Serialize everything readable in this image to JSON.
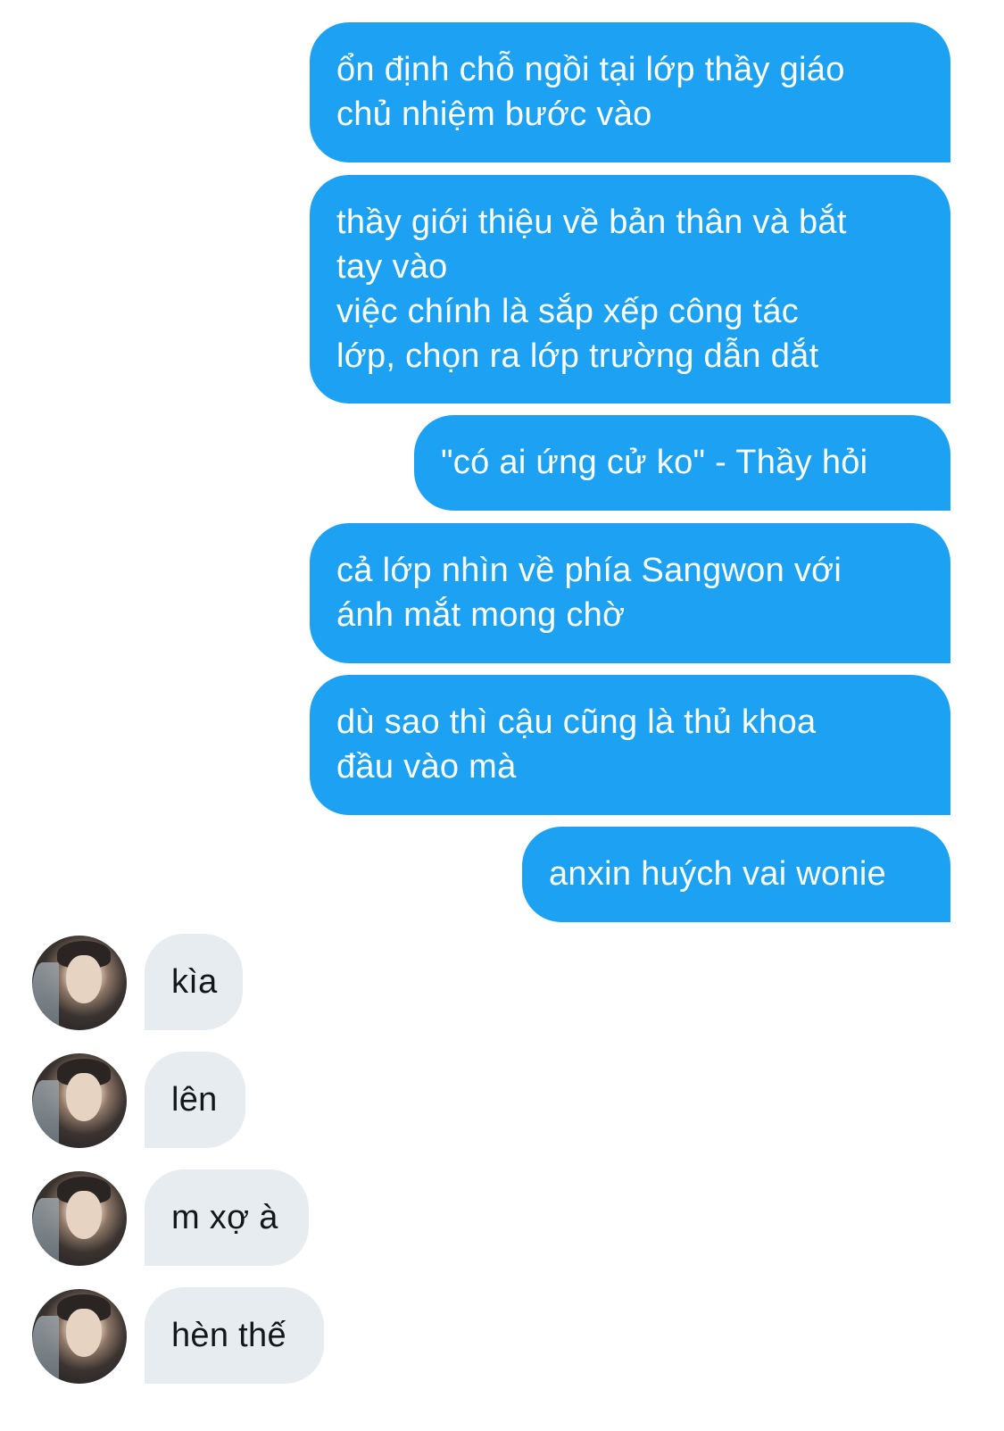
{
  "outgoing_messages": [
    "ổn định chỗ ngồi tại lớp thầy giáo\nchủ nhiệm bước vào",
    "thầy giới thiệu về bản thân và bắt\ntay vào\nviệc chính là sắp xếp công tác\nlớp, chọn ra lớp trường dẫn dắt",
    "\"có ai ứng cử ko\" - Thầy hỏi",
    "cả lớp nhìn về phía Sangwon với\nánh mắt mong chờ",
    "dù sao thì cậu cũng là thủ khoa\nđầu vào mà",
    "anxin huých vai wonie"
  ],
  "incoming_messages": [
    "kìa",
    "lên",
    "m xợ à",
    "hèn thế"
  ],
  "colors": {
    "outgoing_bubble": "#1da1f2",
    "incoming_bubble": "#e6ecf0",
    "outgoing_text": "#ffffff",
    "incoming_text": "#14171a"
  }
}
